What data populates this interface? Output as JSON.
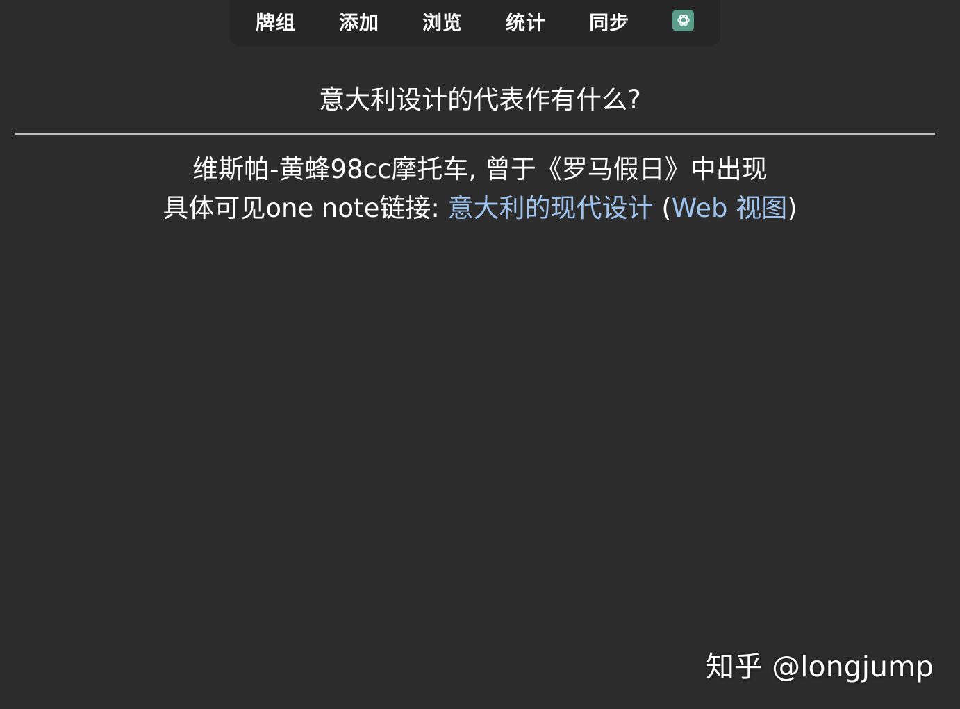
{
  "toolbar": {
    "items": [
      {
        "label": "牌组"
      },
      {
        "label": "添加"
      },
      {
        "label": "浏览"
      },
      {
        "label": "统计"
      },
      {
        "label": "同步"
      }
    ],
    "ai_icon": "chatgpt-logo-icon",
    "ai_icon_color": "#5a9e89"
  },
  "card": {
    "question": "意大利设计的代表作有什么?",
    "answer_line1": "维斯帕-黄蜂98cc摩托车, 曾于《罗马假日》中出现",
    "answer_line2_prefix": "具体可见one note链接:",
    "link1_text": "意大利的现代设计",
    "paren_open": "(",
    "link2_text": "Web 视图",
    "paren_close": ")",
    "link_color": "#9dc3ee"
  },
  "watermark": {
    "text": "知乎 @longjump"
  },
  "colors": {
    "background": "#2c2c2c",
    "toolbar_background": "#262626",
    "divider": "#bfbfbf"
  }
}
